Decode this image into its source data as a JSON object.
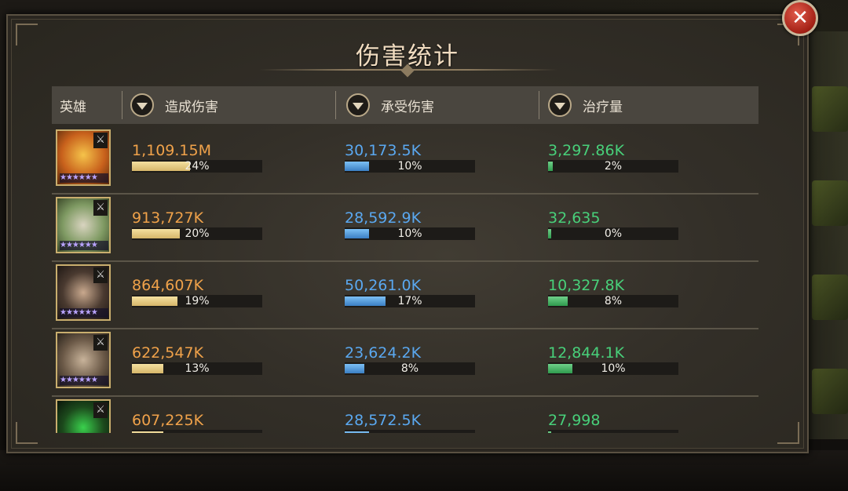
{
  "dialog": {
    "title": "伤害统计",
    "close_label": "✕"
  },
  "table": {
    "columns": [
      {
        "label": "英雄"
      },
      {
        "label": "造成伤害"
      },
      {
        "label": "承受伤害"
      },
      {
        "label": "治疗量"
      }
    ],
    "rows": [
      {
        "role_icon": "sword-icon",
        "stars": 6,
        "stars_text": "★★★★★★",
        "dealt": "1,109.15M",
        "dealt_pct": "24%",
        "dealt_frac": 0.24,
        "taken": "30,173.5K",
        "taken_pct": "10%",
        "taken_frac": 0.1,
        "healed": "3,297.86K",
        "healed_pct": "2%",
        "healed_frac": 0.02
      },
      {
        "role_icon": "sword-icon",
        "stars": 6,
        "stars_text": "★★★★★★",
        "dealt": "913,727K",
        "dealt_pct": "20%",
        "dealt_frac": 0.2,
        "taken": "28,592.9K",
        "taken_pct": "10%",
        "taken_frac": 0.1,
        "healed": "32,635",
        "healed_pct": "0%",
        "healed_frac": 0.0
      },
      {
        "role_icon": "sword-icon",
        "stars": 6,
        "stars_text": "★★★★★★",
        "dealt": "864,607K",
        "dealt_pct": "19%",
        "dealt_frac": 0.19,
        "taken": "50,261.0K",
        "taken_pct": "17%",
        "taken_frac": 0.17,
        "healed": "10,327.8K",
        "healed_pct": "8%",
        "healed_frac": 0.08
      },
      {
        "role_icon": "sword-icon",
        "stars": 6,
        "stars_text": "★★★★★★",
        "dealt": "622,547K",
        "dealt_pct": "13%",
        "dealt_frac": 0.13,
        "taken": "23,624.2K",
        "taken_pct": "8%",
        "taken_frac": 0.08,
        "healed": "12,844.1K",
        "healed_pct": "10%",
        "healed_frac": 0.1
      },
      {
        "role_icon": "crossed-swords-icon",
        "stars": 0,
        "stars_text": "",
        "dealt": "607,225K",
        "dealt_pct": "",
        "dealt_frac": 0.13,
        "taken": "28,572.5K",
        "taken_pct": "",
        "taken_frac": 0.1,
        "healed": "27,998",
        "healed_pct": "",
        "healed_frac": 0.0
      }
    ]
  },
  "colors": {
    "dealt": "#f0a24a",
    "taken": "#5aa8f0",
    "healed": "#48d07a"
  }
}
